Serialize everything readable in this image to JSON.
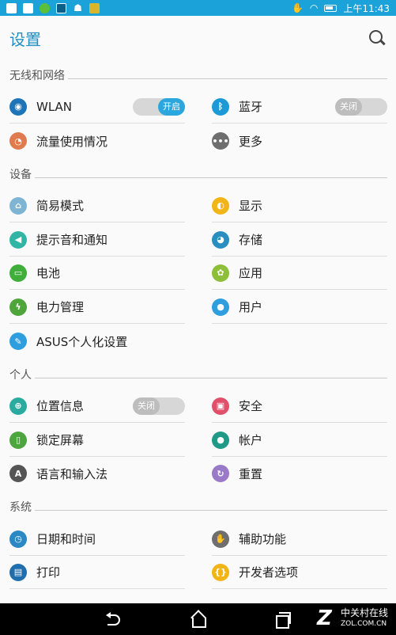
{
  "status_bar": {
    "time": "上午11:43"
  },
  "header": {
    "title": "设置"
  },
  "sections": {
    "wireless": "无线和网络",
    "device": "设备",
    "personal": "个人",
    "system": "系统"
  },
  "items": {
    "wlan": {
      "label": "WLAN",
      "toggle": "开启",
      "icon": "wifi-icon",
      "color": "#1f74b8"
    },
    "bluetooth": {
      "label": "蓝牙",
      "toggle": "关闭",
      "icon": "bluetooth-icon",
      "color": "#1d9ad6"
    },
    "data_usage": {
      "label": "流量使用情况",
      "icon": "data-usage-icon",
      "color": "#e07a4f"
    },
    "more": {
      "label": "更多",
      "icon": "more-icon",
      "color": "#6e6e6e"
    },
    "easy_mode": {
      "label": "简易模式",
      "icon": "easy-mode-icon",
      "color": "#7fb5d4"
    },
    "display": {
      "label": "显示",
      "icon": "display-icon",
      "color": "#f2b517"
    },
    "sound": {
      "label": "提示音和通知",
      "icon": "sound-icon",
      "color": "#33b5a5"
    },
    "storage": {
      "label": "存储",
      "icon": "storage-icon",
      "color": "#2a8fc0"
    },
    "battery": {
      "label": "电池",
      "icon": "battery-icon",
      "color": "#3fae3a"
    },
    "apps": {
      "label": "应用",
      "icon": "apps-icon",
      "color": "#8dbf3a"
    },
    "power": {
      "label": "电力管理",
      "icon": "power-icon",
      "color": "#4ea53a"
    },
    "users": {
      "label": "用户",
      "icon": "user-icon",
      "color": "#2e9ede"
    },
    "asus": {
      "label": "ASUS个人化设置",
      "icon": "asus-customize-icon",
      "color": "#2e9ede"
    },
    "location": {
      "label": "位置信息",
      "toggle": "关闭",
      "icon": "location-icon",
      "color": "#2bab9f"
    },
    "security": {
      "label": "安全",
      "icon": "lock-icon",
      "color": "#e0506a"
    },
    "lock_screen": {
      "label": "锁定屏幕",
      "icon": "lock-screen-icon",
      "color": "#4ca53d"
    },
    "accounts": {
      "label": "帐户",
      "icon": "account-icon",
      "color": "#1e9a86"
    },
    "language": {
      "label": "语言和输入法",
      "icon": "language-icon",
      "color": "#555555"
    },
    "reset": {
      "label": "重置",
      "icon": "reset-icon",
      "color": "#9a7ac8"
    },
    "datetime": {
      "label": "日期和时间",
      "icon": "clock-icon",
      "color": "#2a88c4"
    },
    "accessibility": {
      "label": "辅助功能",
      "icon": "hand-icon",
      "color": "#6e6e6e"
    },
    "print": {
      "label": "打印",
      "icon": "print-icon",
      "color": "#1f6fae"
    },
    "developer": {
      "label": "开发者选项",
      "icon": "developer-icon",
      "color": "#f2b517"
    }
  },
  "watermark": {
    "logo": "Z",
    "cn": "中关村在线",
    "en": "ZOL.COM.CN"
  }
}
